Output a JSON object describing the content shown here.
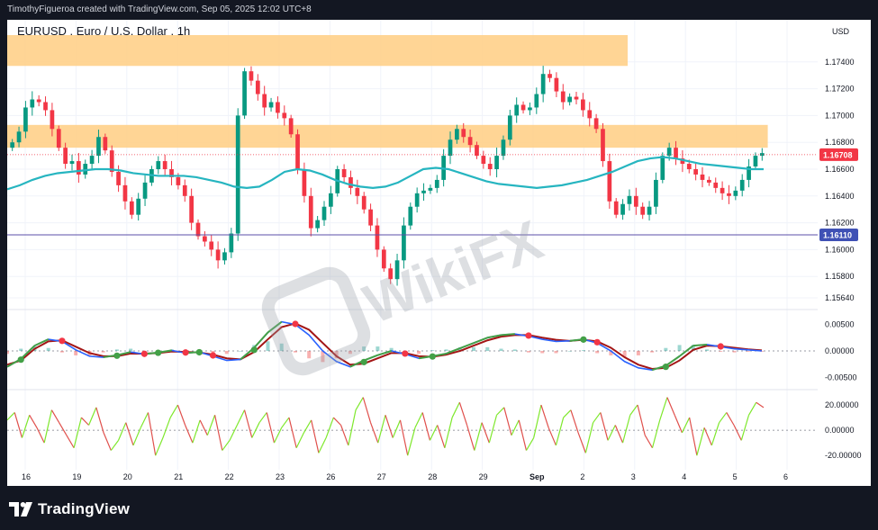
{
  "header": {
    "attribution": "TimothyFigueroa created with TradingView.com, Sep 05, 2025 12:02 UTC+8"
  },
  "footer": {
    "brand": "TradingView"
  },
  "watermark": {
    "text": "WikiFX"
  },
  "colors": {
    "frame_bg": "#131722",
    "zone": "#ffd08a",
    "ma_line": "#26b5c0",
    "support_line": "#5b4fa8",
    "up_candle": "#089981",
    "down_candle": "#f23645",
    "macd_fast": "#2962ff",
    "macd_signal": "#a31515",
    "macd_green": "#43a047",
    "osc_up": "#7ee82c",
    "osc_down": "#e0504c",
    "last_price_bg": "#f23645",
    "level_bg": "#3f51b5"
  },
  "chart_data": [
    {
      "type": "candlestick",
      "title": "EURUSD . Euro / U.S. Dollar . 1h",
      "currency": "USD",
      "x_labels": [
        "16",
        "19",
        "20",
        "21",
        "22",
        "23",
        "26",
        "27",
        "28",
        "29",
        "Sep",
        "2",
        "3",
        "4",
        "5",
        "6"
      ],
      "y_ticks": [
        "1.17400",
        "1.17200",
        "1.17000",
        "1.16800",
        "1.16600",
        "1.16400",
        "1.16200",
        "1.16000",
        "1.15800",
        "1.15640"
      ],
      "ylim": [
        1.1558,
        1.1762
      ],
      "last_price": {
        "label": "1.16708",
        "value": 1.16708
      },
      "support_level": {
        "label": "1.16110",
        "value": 1.1611
      },
      "resistance_zones": [
        {
          "from_label": "16",
          "to_label": "Sep",
          "y_low": 1.1737,
          "y_high": 1.176
        },
        {
          "from_label": "16",
          "to_label": "5",
          "y_low": 1.1676,
          "y_high": 1.1693
        }
      ],
      "close_series": [
        1.168,
        1.1688,
        1.1706,
        1.1712,
        1.171,
        1.1704,
        1.169,
        1.1676,
        1.1664,
        1.1666,
        1.1656,
        1.1664,
        1.167,
        1.1684,
        1.1674,
        1.1658,
        1.1648,
        1.1636,
        1.1626,
        1.1638,
        1.165,
        1.166,
        1.1666,
        1.166,
        1.1654,
        1.1648,
        1.164,
        1.162,
        1.161,
        1.1606,
        1.16,
        1.1592,
        1.1598,
        1.1612,
        1.17,
        1.1733,
        1.1726,
        1.1716,
        1.1706,
        1.171,
        1.1702,
        1.1698,
        1.1686,
        1.166,
        1.164,
        1.1616,
        1.1622,
        1.1632,
        1.1642,
        1.166,
        1.1654,
        1.1646,
        1.164,
        1.163,
        1.1618,
        1.16,
        1.1586,
        1.1578,
        1.1592,
        1.1618,
        1.1632,
        1.1642,
        1.1644,
        1.1646,
        1.1652,
        1.167,
        1.1682,
        1.169,
        1.1684,
        1.1678,
        1.167,
        1.1664,
        1.166,
        1.167,
        1.1682,
        1.17,
        1.1708,
        1.1704,
        1.1706,
        1.1716,
        1.1731,
        1.1728,
        1.1718,
        1.171,
        1.1714,
        1.1712,
        1.1704,
        1.1698,
        1.169,
        1.1666,
        1.1636,
        1.1626,
        1.1634,
        1.164,
        1.1632,
        1.1626,
        1.1632,
        1.1652,
        1.167,
        1.1676,
        1.1668,
        1.1664,
        1.166,
        1.1656,
        1.1652,
        1.165,
        1.1646,
        1.1642,
        1.164,
        1.1644,
        1.1652,
        1.1662,
        1.167,
        1.1672
      ],
      "ma_series": [
        1.1645,
        1.1648,
        1.1652,
        1.1655,
        1.1657,
        1.1658,
        1.1659,
        1.166,
        1.166,
        1.1659,
        1.1657,
        1.1656,
        1.1655,
        1.1655,
        1.1655,
        1.1654,
        1.1652,
        1.165,
        1.1647,
        1.1646,
        1.1647,
        1.1652,
        1.1658,
        1.166,
        1.1659,
        1.1656,
        1.1652,
        1.1649,
        1.1647,
        1.1646,
        1.1647,
        1.165,
        1.1655,
        1.166,
        1.1661,
        1.166,
        1.1657,
        1.1654,
        1.1651,
        1.1649,
        1.1648,
        1.1647,
        1.1646,
        1.1647,
        1.1648,
        1.165,
        1.1652,
        1.1655,
        1.1658,
        1.1662,
        1.1666,
        1.1668,
        1.1669,
        1.1668,
        1.1666,
        1.1664,
        1.1663,
        1.1662,
        1.1661,
        1.166,
        1.166
      ]
    },
    {
      "type": "line",
      "title": "",
      "y_ticks": [
        "0.00500",
        "0.00000",
        "-0.00500"
      ],
      "ylim": [
        -0.0068,
        0.0068
      ],
      "fast_series": [
        -0.003,
        -0.0015,
        0.001,
        0.0022,
        0.0018,
        0.0002,
        -0.001,
        -0.0012,
        -0.0008,
        -0.0002,
        -0.0006,
        -0.0003,
        0.0001,
        -0.0004,
        -0.0002,
        -0.001,
        -0.0018,
        -0.0016,
        0.0006,
        0.0035,
        0.0055,
        0.005,
        0.003,
        0.0,
        -0.002,
        -0.003,
        -0.0018,
        -0.0008,
        0.0,
        -0.0006,
        -0.0014,
        -0.001,
        -0.0005,
        0.0005,
        0.0015,
        0.0025,
        0.003,
        0.0032,
        0.0028,
        0.0022,
        0.0018,
        0.0019,
        0.0022,
        0.0015,
        0.0,
        -0.002,
        -0.0032,
        -0.0036,
        -0.0028,
        -0.001,
        0.001,
        0.0012,
        0.0008,
        0.0004,
        0.0002,
        0.0
      ],
      "signal_series": [
        -0.0026,
        -0.0018,
        0.0004,
        0.0018,
        0.002,
        0.0008,
        -0.0004,
        -0.001,
        -0.001,
        -0.0005,
        -0.0005,
        -0.0004,
        -0.0001,
        -0.0002,
        -0.0003,
        -0.0007,
        -0.0014,
        -0.0016,
        -0.0002,
        0.0022,
        0.0045,
        0.0052,
        0.004,
        0.0015,
        -0.001,
        -0.0026,
        -0.0024,
        -0.0014,
        -0.0004,
        -0.0004,
        -0.001,
        -0.0011,
        -0.0007,
        0.0,
        0.001,
        0.002,
        0.0027,
        0.003,
        0.003,
        0.0025,
        0.0021,
        0.0019,
        0.0021,
        0.0018,
        0.0006,
        -0.0012,
        -0.0026,
        -0.0034,
        -0.0032,
        -0.0018,
        0.0002,
        0.001,
        0.0009,
        0.0006,
        0.0003,
        0.0001
      ]
    },
    {
      "type": "line",
      "title": "",
      "y_ticks": [
        "20.00000",
        "0.00000",
        "-20.00000"
      ],
      "ylim": [
        -27,
        30
      ],
      "series": [
        8,
        14,
        -6,
        12,
        2,
        -10,
        16,
        6,
        -4,
        -14,
        10,
        4,
        18,
        -2,
        -16,
        -8,
        6,
        -12,
        2,
        14,
        -20,
        -6,
        10,
        20,
        4,
        -10,
        8,
        -4,
        12,
        -16,
        -8,
        4,
        16,
        -6,
        6,
        14,
        -10,
        2,
        10,
        -14,
        -2,
        8,
        -18,
        -6,
        10,
        4,
        -12,
        16,
        26,
        6,
        -10,
        12,
        -6,
        8,
        -20,
        2,
        14,
        -8,
        4,
        -14,
        10,
        22,
        4,
        -16,
        6,
        -10,
        12,
        18,
        -4,
        8,
        -16,
        -6,
        20,
        2,
        -12,
        10,
        16,
        -2,
        -18,
        6,
        14,
        -8,
        4,
        -10,
        12,
        20,
        -4,
        -14,
        8,
        26,
        12,
        -2,
        10,
        -20,
        2,
        -12,
        6,
        14,
        4,
        -8,
        12,
        22,
        18
      ]
    }
  ]
}
